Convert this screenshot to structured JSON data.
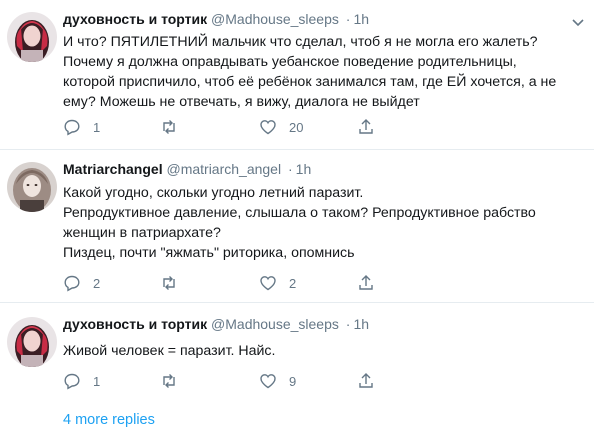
{
  "tweets": [
    {
      "name": "духовность и тортик",
      "handle": "@Madhouse_sleeps",
      "separator": "·",
      "time": "1h",
      "text": "И что? ПЯТИЛЕТНИЙ мальчик что сделал, чтоб я не могла его жалеть?\nПочему я должна оправдывать уебанское поведение родительницы,\nкоторой приспичило, чтоб её ребёнок занимался там, где ЕЙ хочется, а не\nему? Можешь не отвечать, я вижу, диалога не выйдет",
      "reply_count": "1",
      "retweet_count": "",
      "like_count": "20"
    },
    {
      "name": "Matriarchangel",
      "handle": "@matriarch_angel",
      "separator": "·",
      "time": "1h",
      "text": "Какой угодно, скольки угодно летний паразит.\nРепродуктивное давление, слышала о таком? Репродуктивное рабство\nженщин в патриархате?\nПиздец, почти \"яжмать\" риторика, опомнись",
      "reply_count": "2",
      "retweet_count": "",
      "like_count": "2"
    },
    {
      "name": "духовность и тортик",
      "handle": "@Madhouse_sleeps",
      "separator": "·",
      "time": "1h",
      "text": "Живой человек = паразит. Найс.",
      "reply_count": "1",
      "retweet_count": "",
      "like_count": "9"
    }
  ],
  "more_replies": "4 more replies",
  "icons": {
    "reply": "reply-icon",
    "retweet": "retweet-icon",
    "like": "like-icon",
    "share": "share-icon",
    "menu": "chevron-down-icon"
  },
  "colors": {
    "text": "#14171a",
    "secondary": "#657786",
    "link": "#1da1f2",
    "divider": "#e6ecf0"
  }
}
